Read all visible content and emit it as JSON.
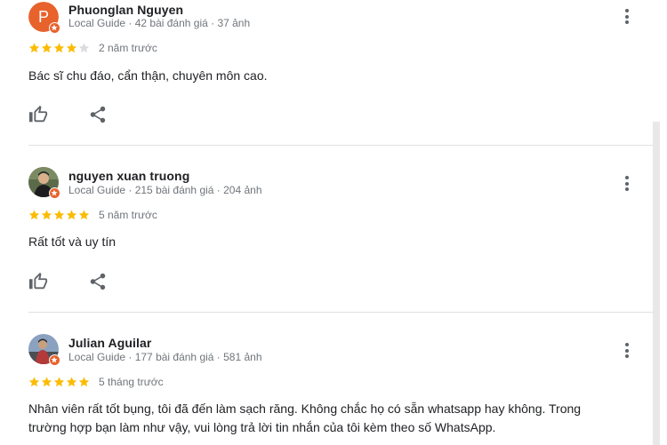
{
  "reviews": [
    {
      "name": "Phuonglan Nguyen",
      "avatar_letter": "P",
      "meta": "Local Guide · 42 bài đánh giá · 37 ảnh",
      "rating": 4,
      "ago": "2 năm trước",
      "text": "Bác sĩ chu đáo, cẩn thận, chuyên môn cao."
    },
    {
      "name": "nguyen xuan truong",
      "meta": "Local Guide · 215 bài đánh giá · 204 ảnh",
      "rating": 5,
      "ago": "5 năm trước",
      "text": "Rất tốt và uy tín"
    },
    {
      "name": "Julian Aguilar",
      "meta": "Local Guide · 177 bài đánh giá · 581 ảnh",
      "rating": 5,
      "ago": "5 tháng trước",
      "text": "Nhân viên rất tốt bụng, tôi đã đến làm sạch răng. Không chắc họ có sẵn whatsapp hay không. Trong trường hợp bạn làm như vậy, vui lòng trả lời tin nhắn của tôi kèm theo số WhatsApp."
    }
  ],
  "colors": {
    "star_filled": "#fbbc04",
    "star_empty": "#dadce0",
    "local_guide_badge": "#e8622c",
    "icon": "#5f6368"
  },
  "icons": {
    "more": "more-vert-icon",
    "like": "thumb-up-icon",
    "share": "share-icon",
    "star": "star-icon",
    "badge": "local-guide-badge-icon"
  }
}
